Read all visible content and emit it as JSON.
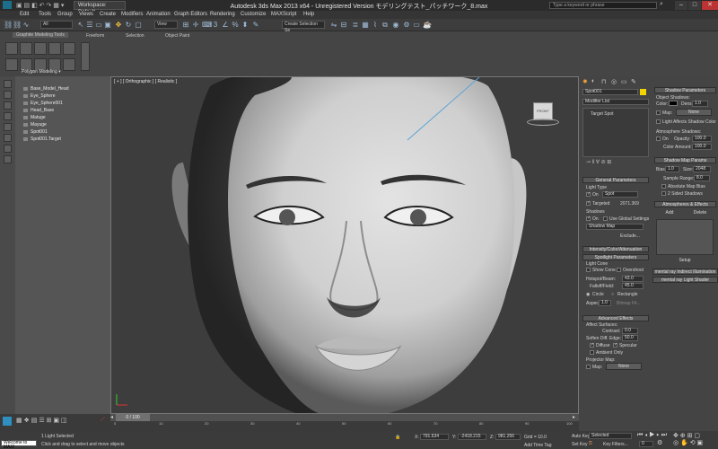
{
  "titlebar": {
    "workspace": "Workspace: Default",
    "title": "Autodesk 3ds Max  2013 x64  -  Unregistered Version   モデリングテスト_パッチワーク_8.max",
    "search_placeholder": "Type a keyword or phrase"
  },
  "menu": [
    "Edit",
    "Tools",
    "Group",
    "Views",
    "Create",
    "Modifiers",
    "Animation",
    "Graph Editors",
    "Rendering",
    "Customize",
    "MAXScript",
    "Help"
  ],
  "toolbar": {
    "selection_filter": "All",
    "ref_coord": "View",
    "named_selection": "Create Selection Se"
  },
  "ribbon": {
    "panel_title": "Graphite Modeling Tools",
    "tabs": [
      "Freeform",
      "Selection",
      "Object Paint"
    ],
    "poly_modeling": "Polygon Modeling ▾"
  },
  "scene_explorer": {
    "items": [
      "Base_Model_Head",
      "Eye_Sphere",
      "Eye_Sphere001",
      "Head_Base",
      "Matuge",
      "Mayuge",
      "Spot001",
      "Spot001.Target"
    ]
  },
  "viewport": {
    "label": "[ + ] [ Orthographic ] [ Realistic ]",
    "viewcube_label": "FRONT"
  },
  "command_panel": {
    "object_name": "Spot001",
    "object_color": "#f2d400",
    "modifier_list": "Modifier List",
    "stack_item": "Target Spot",
    "general_params": {
      "title": "General Parameters",
      "light_type": "Light Type",
      "on": "On",
      "type_value": "Spot",
      "targeted": "Targeted",
      "target_dist": "2071.369",
      "shadows": "Shadows",
      "use_global": "Use Global Settings",
      "shadow_type": "Shadow Map",
      "exclude": "Exclude..."
    },
    "intensity_title": "Intensity/Color/Attenuation",
    "spotlight_params": {
      "title": "Spotlight Parameters",
      "light_cone": "Light Cone",
      "show_cone": "Show Cone",
      "overshoot": "Overshoot",
      "hotspot_label": "Hotspot/Beam:",
      "hotspot_value": "43.0",
      "falloff_label": "Falloff/Field:",
      "falloff_value": "45.0",
      "circle": "Circle",
      "rectangle": "Rectangle",
      "aspect_label": "Aspect:",
      "aspect_value": "1.0",
      "bitmap_fit": "Bitmap Fit..."
    },
    "advanced_effects": {
      "title": "Advanced Effects",
      "affect_surfaces": "Affect Surfaces:",
      "contrast_label": "Contrast:",
      "contrast_value": "0.0",
      "soften_label": "Soften Diff. Edge:",
      "soften_value": "50.0",
      "diffuse": "Diffuse",
      "specular": "Specular",
      "ambient_only": "Ambient Only",
      "projector_map": "Projector Map:",
      "map": "Map:",
      "none": "None"
    }
  },
  "shadow_panel": {
    "shadow_params_title": "Shadow Parameters",
    "object_shadows": "Object Shadows:",
    "color_label": "Color:",
    "dens_label": "Dens.",
    "dens_value": "1.0",
    "map_label": "Map:",
    "map_value": "None",
    "light_affects": "Light Affects Shadow Color",
    "atmos_shadows": "Atmosphere Shadows:",
    "atmos_on": "On",
    "opacity_label": "Opacity:",
    "opacity_value": "100.0",
    "color_amount_label": "Color Amount:",
    "color_amount_value": "100.0",
    "shadow_map_title": "Shadow Map Params",
    "bias_label": "Bias:",
    "bias_value": "1.0",
    "size_label": "Size:",
    "size_value": "2048",
    "sample_range_label": "Sample Range:",
    "sample_range_value": "8.0",
    "absolute_bias": "Absolute Map Bias",
    "two_sided": "2 Sided Shadows",
    "atmos_effects_title": "Atmospheres & Effects",
    "add": "Add",
    "delete": "Delete",
    "setup": "Setup",
    "mr_indirect": "mental ray Indirect Illumination",
    "mr_light_shader": "mental ray Light Shader"
  },
  "timeline": {
    "frame_label": "0 / 100",
    "ticks": [
      "0",
      "10",
      "20",
      "30",
      "40",
      "50",
      "60",
      "70",
      "80",
      "90",
      "100"
    ]
  },
  "status": {
    "maxscript": "Welcome to MAX!",
    "selected": "1 Light Selected",
    "prompt": "Click and drag to select and move objects",
    "x_label": "X:",
    "x_value": "791.634",
    "y_label": "Y:",
    "y_value": "-2418.215",
    "z_label": "Z:",
    "z_value": "981.256",
    "grid": "Grid = 10.0",
    "add_time_tag": "Add Time Tag",
    "auto_key": "Auto Key",
    "set_key": "Set Key",
    "key_mode": "Selected",
    "key_filters": "Key Filters...",
    "frame": "0"
  }
}
